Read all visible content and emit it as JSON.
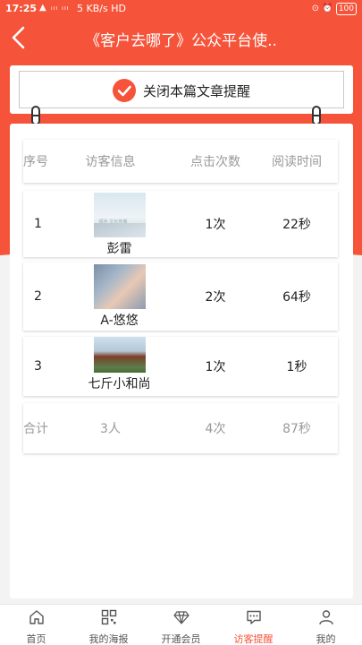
{
  "status_bar": {
    "time": "17:25",
    "signal": "▲ ᵢₗₗ ᵢₗₗ",
    "net_speed": "5 KB/s",
    "net_type": "HD",
    "battery": "100"
  },
  "header": {
    "title": "《客户去哪了》公众平台使..",
    "back_icon": "chevron-left-icon"
  },
  "close_button": {
    "label": "关闭本篇文章提醒"
  },
  "table": {
    "headers": {
      "index": "序号",
      "visitor": "访客信息",
      "clicks": "点击次数",
      "read_time": "阅读时间"
    },
    "rows": [
      {
        "index": "1",
        "name": "彭雷",
        "clicks": "1次",
        "read_time": "22秒",
        "avatar_caption": "福佳-文化传播"
      },
      {
        "index": "2",
        "name": "A-悠悠",
        "clicks": "2次",
        "read_time": "64秒"
      },
      {
        "index": "3",
        "name": "七斤小和尚",
        "clicks": "1次",
        "read_time": "1秒"
      }
    ],
    "total": {
      "label": "合计",
      "visitors": "3人",
      "clicks": "4次",
      "read_time": "87秒"
    }
  },
  "tabs": [
    {
      "label": "首页",
      "icon": "home-icon",
      "active": false
    },
    {
      "label": "我的海报",
      "icon": "qrcode-icon",
      "active": false
    },
    {
      "label": "开通会员",
      "icon": "diamond-icon",
      "active": false
    },
    {
      "label": "访客提醒",
      "icon": "chat-icon",
      "active": true
    },
    {
      "label": "我的",
      "icon": "user-icon",
      "active": false
    }
  ],
  "colors": {
    "brand": "#f6543a",
    "muted_text": "#999999",
    "text": "#222222"
  }
}
